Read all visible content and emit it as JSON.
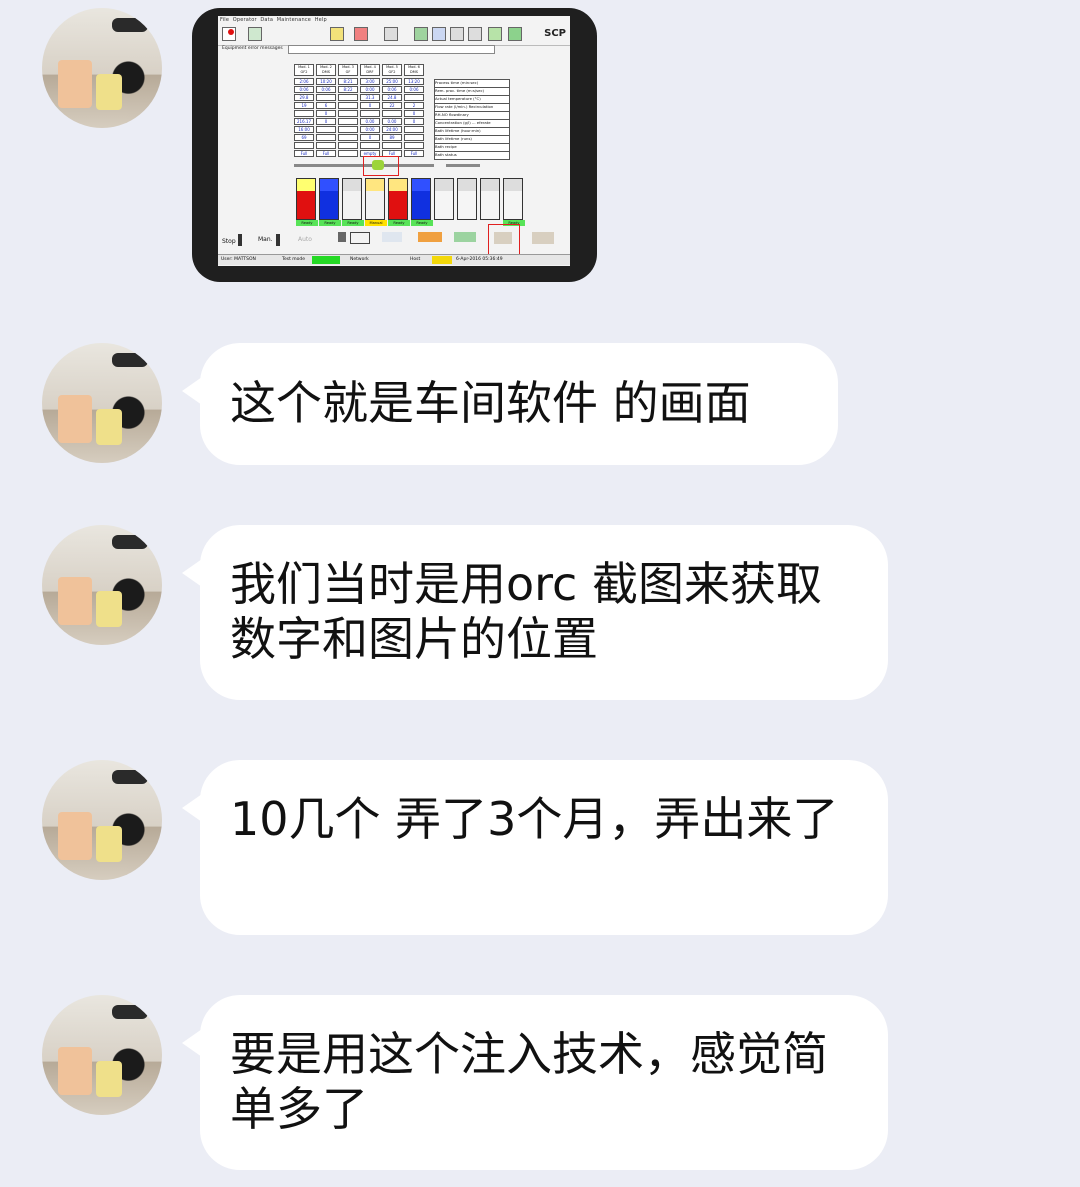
{
  "screenshot": {
    "menu": [
      "File",
      "Operator",
      "Data",
      "Maintenance",
      "Help"
    ],
    "toolbar_brand": "SCP",
    "error_label": "Equipment error messages",
    "table": {
      "headers": [
        "Mod. 1\nGF2",
        "Mod. 2\nDMS",
        "Mod. 3\nGF",
        "Mod. 4\nDRF",
        "Mod. 5\nGF2",
        "Mod. 6\nDMS"
      ],
      "rows": [
        [
          "2:06",
          "10:20",
          "8:21",
          "3:00",
          "25:00",
          "13:20"
        ],
        [
          "0:06",
          "0:06",
          "8:22",
          "0:00",
          "0:06",
          "0:06"
        ],
        [
          "29.8",
          "",
          "",
          "31.3",
          "24.8",
          ""
        ],
        [
          "19",
          "6",
          "",
          "0",
          "22",
          "2"
        ],
        [
          "",
          "0",
          "",
          "",
          "",
          "0"
        ],
        [
          "216.17",
          "0",
          "",
          "0.00",
          "0.00",
          "0"
        ],
        [
          "16:00",
          "",
          "",
          "0:00",
          "24:00",
          ""
        ],
        [
          "69",
          "",
          "",
          "0",
          "89",
          ""
        ],
        [
          "",
          "",
          "",
          "",
          "",
          ""
        ],
        [
          "Full",
          "Full",
          "",
          "empty",
          "Full",
          "Full"
        ]
      ],
      "row_labels": [
        "Process time (min:sec)",
        "Rem. proc. time (m:s/sec)",
        "Actual temperature (°C)",
        "Flow rate (l/min.) Recirculation",
        "RH-NO flowdinary",
        "Concentration (g/l) ... eferate",
        "Bath lifetime (hour:min)",
        "Bath lifetime (runs)",
        "Bath recipe",
        "Bath status"
      ]
    },
    "tank_status": [
      "Ready",
      "Ready",
      "Ready",
      "Manual",
      "Ready",
      "Ready",
      "",
      "",
      "",
      "Ready"
    ],
    "controls": {
      "stop": "Stop",
      "man": "Man.",
      "auto": "Auto"
    },
    "status_bar": {
      "user": "User: MATTSON",
      "mode": "Test mode",
      "network": "Network",
      "host": "Host",
      "date": "6-Apr-2016 05:36:49"
    }
  },
  "messages": [
    "这个就是车间软件 的画面",
    "我们当时是用orc 截图来获取数字和图片的位置",
    "10几个 弄了3个月，弄出来了",
    "要是用这个注入技术，感觉简单多了"
  ]
}
